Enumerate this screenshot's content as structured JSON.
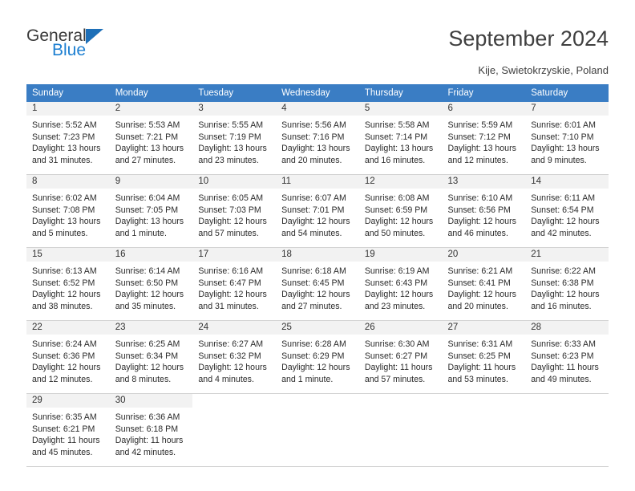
{
  "brand": {
    "name_part1": "General",
    "name_part2": "Blue",
    "triangle_color": "#1d6fb8",
    "blue_color": "#1d7fd1"
  },
  "header": {
    "title": "September 2024",
    "location": "Kije, Swietokrzyskie, Poland"
  },
  "theme": {
    "header_row_bg": "#3a7dc4",
    "daynum_bg": "#f2f2f2",
    "grid_line": "#d4d4d4"
  },
  "weekday_headers": [
    "Sunday",
    "Monday",
    "Tuesday",
    "Wednesday",
    "Thursday",
    "Friday",
    "Saturday"
  ],
  "weeks": [
    [
      {
        "day": "1",
        "sunrise": "Sunrise: 5:52 AM",
        "sunset": "Sunset: 7:23 PM",
        "daylight1": "Daylight: 13 hours",
        "daylight2": "and 31 minutes."
      },
      {
        "day": "2",
        "sunrise": "Sunrise: 5:53 AM",
        "sunset": "Sunset: 7:21 PM",
        "daylight1": "Daylight: 13 hours",
        "daylight2": "and 27 minutes."
      },
      {
        "day": "3",
        "sunrise": "Sunrise: 5:55 AM",
        "sunset": "Sunset: 7:19 PM",
        "daylight1": "Daylight: 13 hours",
        "daylight2": "and 23 minutes."
      },
      {
        "day": "4",
        "sunrise": "Sunrise: 5:56 AM",
        "sunset": "Sunset: 7:16 PM",
        "daylight1": "Daylight: 13 hours",
        "daylight2": "and 20 minutes."
      },
      {
        "day": "5",
        "sunrise": "Sunrise: 5:58 AM",
        "sunset": "Sunset: 7:14 PM",
        "daylight1": "Daylight: 13 hours",
        "daylight2": "and 16 minutes."
      },
      {
        "day": "6",
        "sunrise": "Sunrise: 5:59 AM",
        "sunset": "Sunset: 7:12 PM",
        "daylight1": "Daylight: 13 hours",
        "daylight2": "and 12 minutes."
      },
      {
        "day": "7",
        "sunrise": "Sunrise: 6:01 AM",
        "sunset": "Sunset: 7:10 PM",
        "daylight1": "Daylight: 13 hours",
        "daylight2": "and 9 minutes."
      }
    ],
    [
      {
        "day": "8",
        "sunrise": "Sunrise: 6:02 AM",
        "sunset": "Sunset: 7:08 PM",
        "daylight1": "Daylight: 13 hours",
        "daylight2": "and 5 minutes."
      },
      {
        "day": "9",
        "sunrise": "Sunrise: 6:04 AM",
        "sunset": "Sunset: 7:05 PM",
        "daylight1": "Daylight: 13 hours",
        "daylight2": "and 1 minute."
      },
      {
        "day": "10",
        "sunrise": "Sunrise: 6:05 AM",
        "sunset": "Sunset: 7:03 PM",
        "daylight1": "Daylight: 12 hours",
        "daylight2": "and 57 minutes."
      },
      {
        "day": "11",
        "sunrise": "Sunrise: 6:07 AM",
        "sunset": "Sunset: 7:01 PM",
        "daylight1": "Daylight: 12 hours",
        "daylight2": "and 54 minutes."
      },
      {
        "day": "12",
        "sunrise": "Sunrise: 6:08 AM",
        "sunset": "Sunset: 6:59 PM",
        "daylight1": "Daylight: 12 hours",
        "daylight2": "and 50 minutes."
      },
      {
        "day": "13",
        "sunrise": "Sunrise: 6:10 AM",
        "sunset": "Sunset: 6:56 PM",
        "daylight1": "Daylight: 12 hours",
        "daylight2": "and 46 minutes."
      },
      {
        "day": "14",
        "sunrise": "Sunrise: 6:11 AM",
        "sunset": "Sunset: 6:54 PM",
        "daylight1": "Daylight: 12 hours",
        "daylight2": "and 42 minutes."
      }
    ],
    [
      {
        "day": "15",
        "sunrise": "Sunrise: 6:13 AM",
        "sunset": "Sunset: 6:52 PM",
        "daylight1": "Daylight: 12 hours",
        "daylight2": "and 38 minutes."
      },
      {
        "day": "16",
        "sunrise": "Sunrise: 6:14 AM",
        "sunset": "Sunset: 6:50 PM",
        "daylight1": "Daylight: 12 hours",
        "daylight2": "and 35 minutes."
      },
      {
        "day": "17",
        "sunrise": "Sunrise: 6:16 AM",
        "sunset": "Sunset: 6:47 PM",
        "daylight1": "Daylight: 12 hours",
        "daylight2": "and 31 minutes."
      },
      {
        "day": "18",
        "sunrise": "Sunrise: 6:18 AM",
        "sunset": "Sunset: 6:45 PM",
        "daylight1": "Daylight: 12 hours",
        "daylight2": "and 27 minutes."
      },
      {
        "day": "19",
        "sunrise": "Sunrise: 6:19 AM",
        "sunset": "Sunset: 6:43 PM",
        "daylight1": "Daylight: 12 hours",
        "daylight2": "and 23 minutes."
      },
      {
        "day": "20",
        "sunrise": "Sunrise: 6:21 AM",
        "sunset": "Sunset: 6:41 PM",
        "daylight1": "Daylight: 12 hours",
        "daylight2": "and 20 minutes."
      },
      {
        "day": "21",
        "sunrise": "Sunrise: 6:22 AM",
        "sunset": "Sunset: 6:38 PM",
        "daylight1": "Daylight: 12 hours",
        "daylight2": "and 16 minutes."
      }
    ],
    [
      {
        "day": "22",
        "sunrise": "Sunrise: 6:24 AM",
        "sunset": "Sunset: 6:36 PM",
        "daylight1": "Daylight: 12 hours",
        "daylight2": "and 12 minutes."
      },
      {
        "day": "23",
        "sunrise": "Sunrise: 6:25 AM",
        "sunset": "Sunset: 6:34 PM",
        "daylight1": "Daylight: 12 hours",
        "daylight2": "and 8 minutes."
      },
      {
        "day": "24",
        "sunrise": "Sunrise: 6:27 AM",
        "sunset": "Sunset: 6:32 PM",
        "daylight1": "Daylight: 12 hours",
        "daylight2": "and 4 minutes."
      },
      {
        "day": "25",
        "sunrise": "Sunrise: 6:28 AM",
        "sunset": "Sunset: 6:29 PM",
        "daylight1": "Daylight: 12 hours",
        "daylight2": "and 1 minute."
      },
      {
        "day": "26",
        "sunrise": "Sunrise: 6:30 AM",
        "sunset": "Sunset: 6:27 PM",
        "daylight1": "Daylight: 11 hours",
        "daylight2": "and 57 minutes."
      },
      {
        "day": "27",
        "sunrise": "Sunrise: 6:31 AM",
        "sunset": "Sunset: 6:25 PM",
        "daylight1": "Daylight: 11 hours",
        "daylight2": "and 53 minutes."
      },
      {
        "day": "28",
        "sunrise": "Sunrise: 6:33 AM",
        "sunset": "Sunset: 6:23 PM",
        "daylight1": "Daylight: 11 hours",
        "daylight2": "and 49 minutes."
      }
    ],
    [
      {
        "day": "29",
        "sunrise": "Sunrise: 6:35 AM",
        "sunset": "Sunset: 6:21 PM",
        "daylight1": "Daylight: 11 hours",
        "daylight2": "and 45 minutes."
      },
      {
        "day": "30",
        "sunrise": "Sunrise: 6:36 AM",
        "sunset": "Sunset: 6:18 PM",
        "daylight1": "Daylight: 11 hours",
        "daylight2": "and 42 minutes."
      },
      {
        "day": "",
        "sunrise": "",
        "sunset": "",
        "daylight1": "",
        "daylight2": ""
      },
      {
        "day": "",
        "sunrise": "",
        "sunset": "",
        "daylight1": "",
        "daylight2": ""
      },
      {
        "day": "",
        "sunrise": "",
        "sunset": "",
        "daylight1": "",
        "daylight2": ""
      },
      {
        "day": "",
        "sunrise": "",
        "sunset": "",
        "daylight1": "",
        "daylight2": ""
      },
      {
        "day": "",
        "sunrise": "",
        "sunset": "",
        "daylight1": "",
        "daylight2": ""
      }
    ]
  ]
}
